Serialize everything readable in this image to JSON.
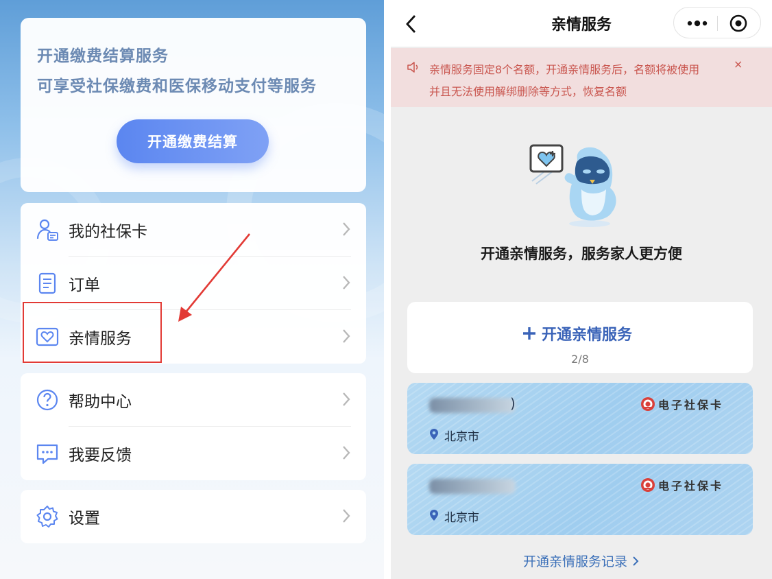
{
  "left": {
    "promo": {
      "title": "开通缴费结算服务",
      "subtitle": "可享受社保缴费和医保移动支付等服务",
      "button_label": "开通缴费结算"
    },
    "menu": [
      {
        "label": "我的社保卡",
        "icon": "person-card-icon"
      },
      {
        "label": "订单",
        "icon": "document-icon"
      },
      {
        "label": "亲情服务",
        "icon": "heart-card-icon"
      },
      {
        "label": "帮助中心",
        "icon": "question-circle-icon"
      },
      {
        "label": "我要反馈",
        "icon": "chat-bubble-icon"
      },
      {
        "label": "设置",
        "icon": "gear-icon"
      }
    ],
    "highlighted_item": "亲情服务",
    "annotation_color": "#e23a35"
  },
  "right": {
    "header": {
      "title": "亲情服务"
    },
    "notice": {
      "line1": "亲情服务固定8个名额，开通亲情服务后，名额将被使用",
      "line2": "并且无法使用解绑删除等方式，恢复名额",
      "close": "×"
    },
    "tagline": "开通亲情服务，服务家人更方便",
    "open_service": {
      "label": "开通亲情服务",
      "quota_used": "2/8"
    },
    "members": [
      {
        "name_suffix": ")",
        "location": "北京市",
        "badge": "电子社保卡"
      },
      {
        "name_suffix": "",
        "location": "北京市",
        "badge": "电子社保卡"
      }
    ],
    "history_link": "开通亲情服务记录"
  },
  "colors": {
    "accent_blue": "#3a63b8",
    "promo_button": "#5b86f0",
    "notice_text": "#c9564f",
    "notice_bg": "#f2dede"
  }
}
